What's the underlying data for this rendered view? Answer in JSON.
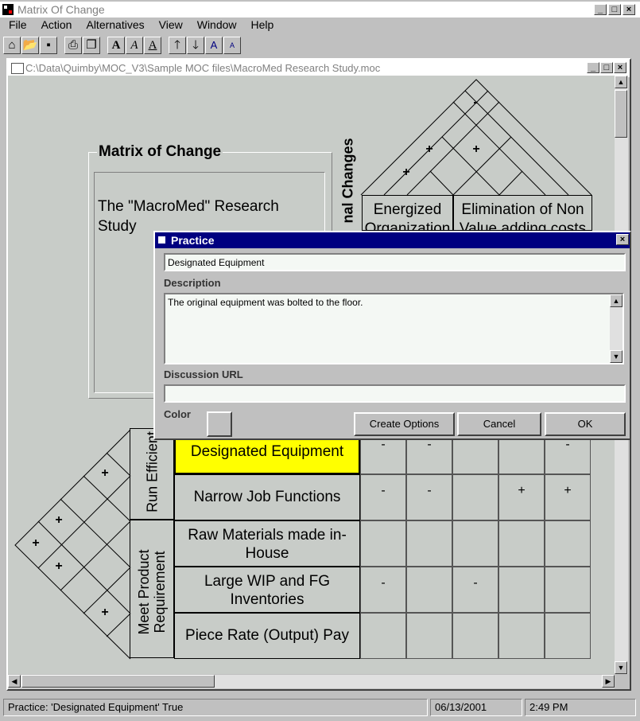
{
  "app": {
    "title": "Matrix Of Change"
  },
  "menu": [
    "File",
    "Action",
    "Alternatives",
    "View",
    "Window",
    "Help"
  ],
  "document": {
    "title": "C:\\Data\\Quimby\\MOC_V3\\Sample MOC files\\MacroMed Research Study.moc"
  },
  "matrix": {
    "panel_title": "Matrix of Change",
    "study_name": "The \"MacroMed\" Research Study",
    "changes_heading": "nal Changes",
    "columns": [
      "Energized Organization",
      "Elimination of Non Value adding costs"
    ],
    "groups": [
      "Run Efficient",
      "Meet Product Requirement"
    ],
    "rows": [
      "Designated Equipment",
      "Narrow Job Functions",
      "Raw Materials made in-House",
      "Large WIP and FG Inventories",
      "Piece Rate (Output) Pay"
    ],
    "cell_marks": [
      [
        "-",
        "-",
        "",
        "",
        "-"
      ],
      [
        "-",
        "-",
        "",
        "+",
        "+"
      ],
      [
        "",
        "",
        "",
        "",
        ""
      ],
      [
        "-",
        "",
        "-",
        "",
        ""
      ],
      [
        "",
        "",
        "",
        "",
        ""
      ]
    ],
    "top_roof_marks": [
      "-",
      "+",
      "+",
      "+"
    ],
    "left_roof_marks": [
      "+",
      "+",
      "+",
      "+",
      "+"
    ]
  },
  "dialog": {
    "title": "Practice",
    "name_value": "Designated Equipment",
    "description_label": "Description",
    "description_value": "The original equipment was bolted to the floor.",
    "url_label": "Discussion URL",
    "url_value": "",
    "color_label": "Color",
    "create_options": "Create Options",
    "cancel": "Cancel",
    "ok": "OK",
    "close_glyph": "×"
  },
  "status": {
    "message": "Practice: 'Designated Equipment' True",
    "date": "06/13/2001",
    "time": "2:49 PM"
  },
  "colors": {
    "highlight": "#ffff00",
    "dialog_title": "#000080"
  }
}
